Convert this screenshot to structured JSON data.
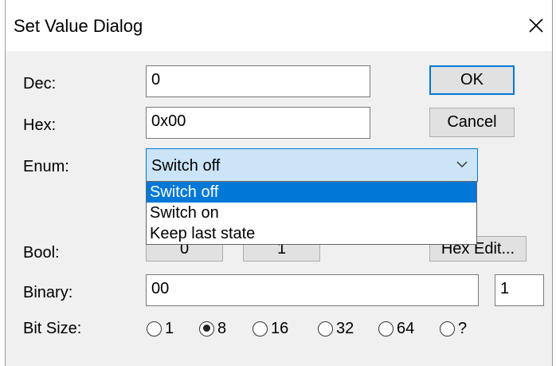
{
  "window": {
    "title": "Set Value Dialog",
    "close_glyph": "×"
  },
  "labels": {
    "dec": "Dec:",
    "hex": "Hex:",
    "enum": "Enum:",
    "bool": "Bool:",
    "binary": "Binary:",
    "bit_size": "Bit Size:"
  },
  "fields": {
    "dec_value": "0",
    "hex_value": "0x00",
    "binary_value": "00",
    "binary_length": "1"
  },
  "buttons": {
    "ok": "OK",
    "cancel": "Cancel",
    "bool_false": "0",
    "bool_true": "1",
    "hex_edit": "Hex Edit..."
  },
  "enum": {
    "selected": "Switch off",
    "options": [
      "Switch off",
      "Switch on",
      "Keep last state"
    ]
  },
  "bit_size": {
    "options": [
      "1",
      "8",
      "16",
      "32",
      "64",
      "?"
    ],
    "selected": "8"
  },
  "colors": {
    "accent": "#0078d7",
    "combo_bg": "#cce4f7",
    "dialog_bg": "#f0f0f0"
  }
}
